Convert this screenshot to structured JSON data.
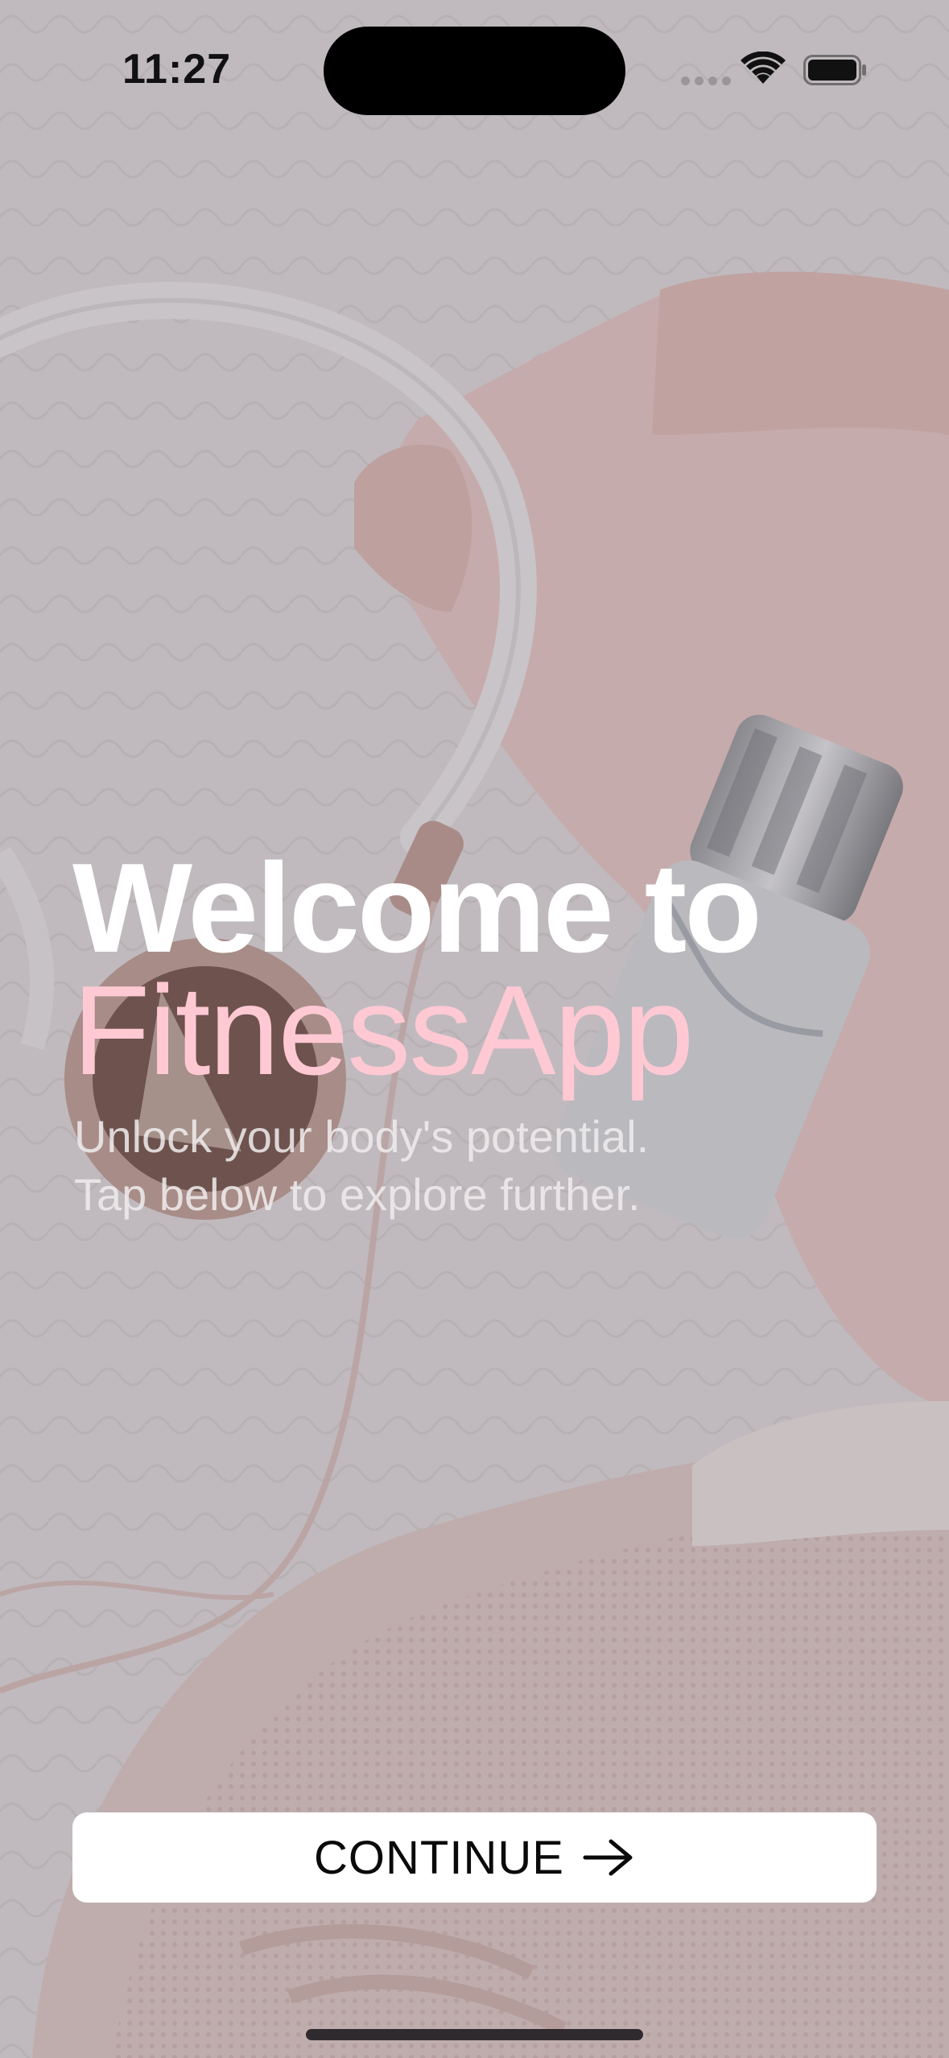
{
  "status_bar": {
    "time": "11:27"
  },
  "hero": {
    "title": "Welcome to",
    "app_name": "FitnessApp",
    "subtitle_line_1": "Unlock your body's potential.",
    "subtitle_line_2": "Tap below to explore further."
  },
  "actions": {
    "continue_label": "CONTINUE",
    "continue_icon": "arrow-right-icon"
  },
  "colors": {
    "accent_pink": "#ffc9d4",
    "title_white": "#ffffff",
    "button_bg": "#ffffff"
  }
}
